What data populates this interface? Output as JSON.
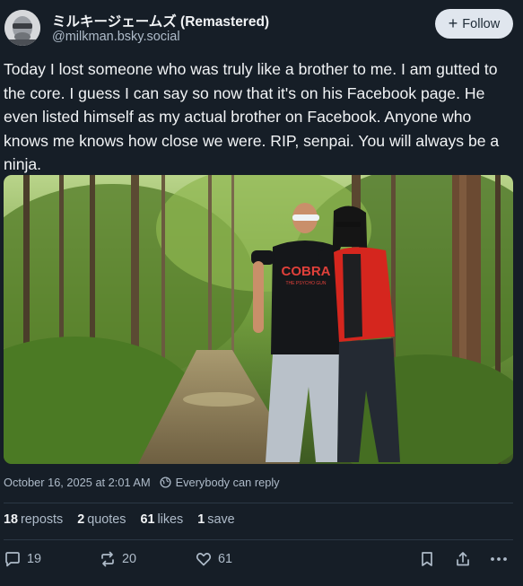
{
  "author": {
    "display_name": "ミルキージェームズ (Remastered)",
    "handle": "@milkman.bsky.social",
    "avatar_icon": "avatar-photo"
  },
  "follow": {
    "label": "Follow",
    "icon": "plus-icon"
  },
  "post": {
    "text": "Today I lost someone who was truly like a brother to me. I am gutted to the core. I guess I can say so now that it's on his Facebook page. He even listed himself as my actual brother on Facebook. Anyone who knows me knows how close we were. RIP, senpai. You will always be a ninja.",
    "image": {
      "shirt_print": "COBRA",
      "shirt_print_sub": "THE PSYCHO GUN"
    }
  },
  "meta": {
    "timestamp": "October 16, 2025 at 2:01 AM",
    "reply_setting": "Everybody can reply"
  },
  "stats": {
    "reposts": {
      "count": "18",
      "label": "reposts"
    },
    "quotes": {
      "count": "2",
      "label": "quotes"
    },
    "likes": {
      "count": "61",
      "label": "likes"
    },
    "saves": {
      "count": "1",
      "label": "save"
    }
  },
  "actions": {
    "reply_count": "19",
    "repost_count": "20",
    "like_count": "61"
  },
  "colors": {
    "background": "#161e27",
    "text": "#f1f3f5",
    "muted": "#aebbc9",
    "follow_bg": "#e0e6ee",
    "divider": "#2b3845"
  }
}
